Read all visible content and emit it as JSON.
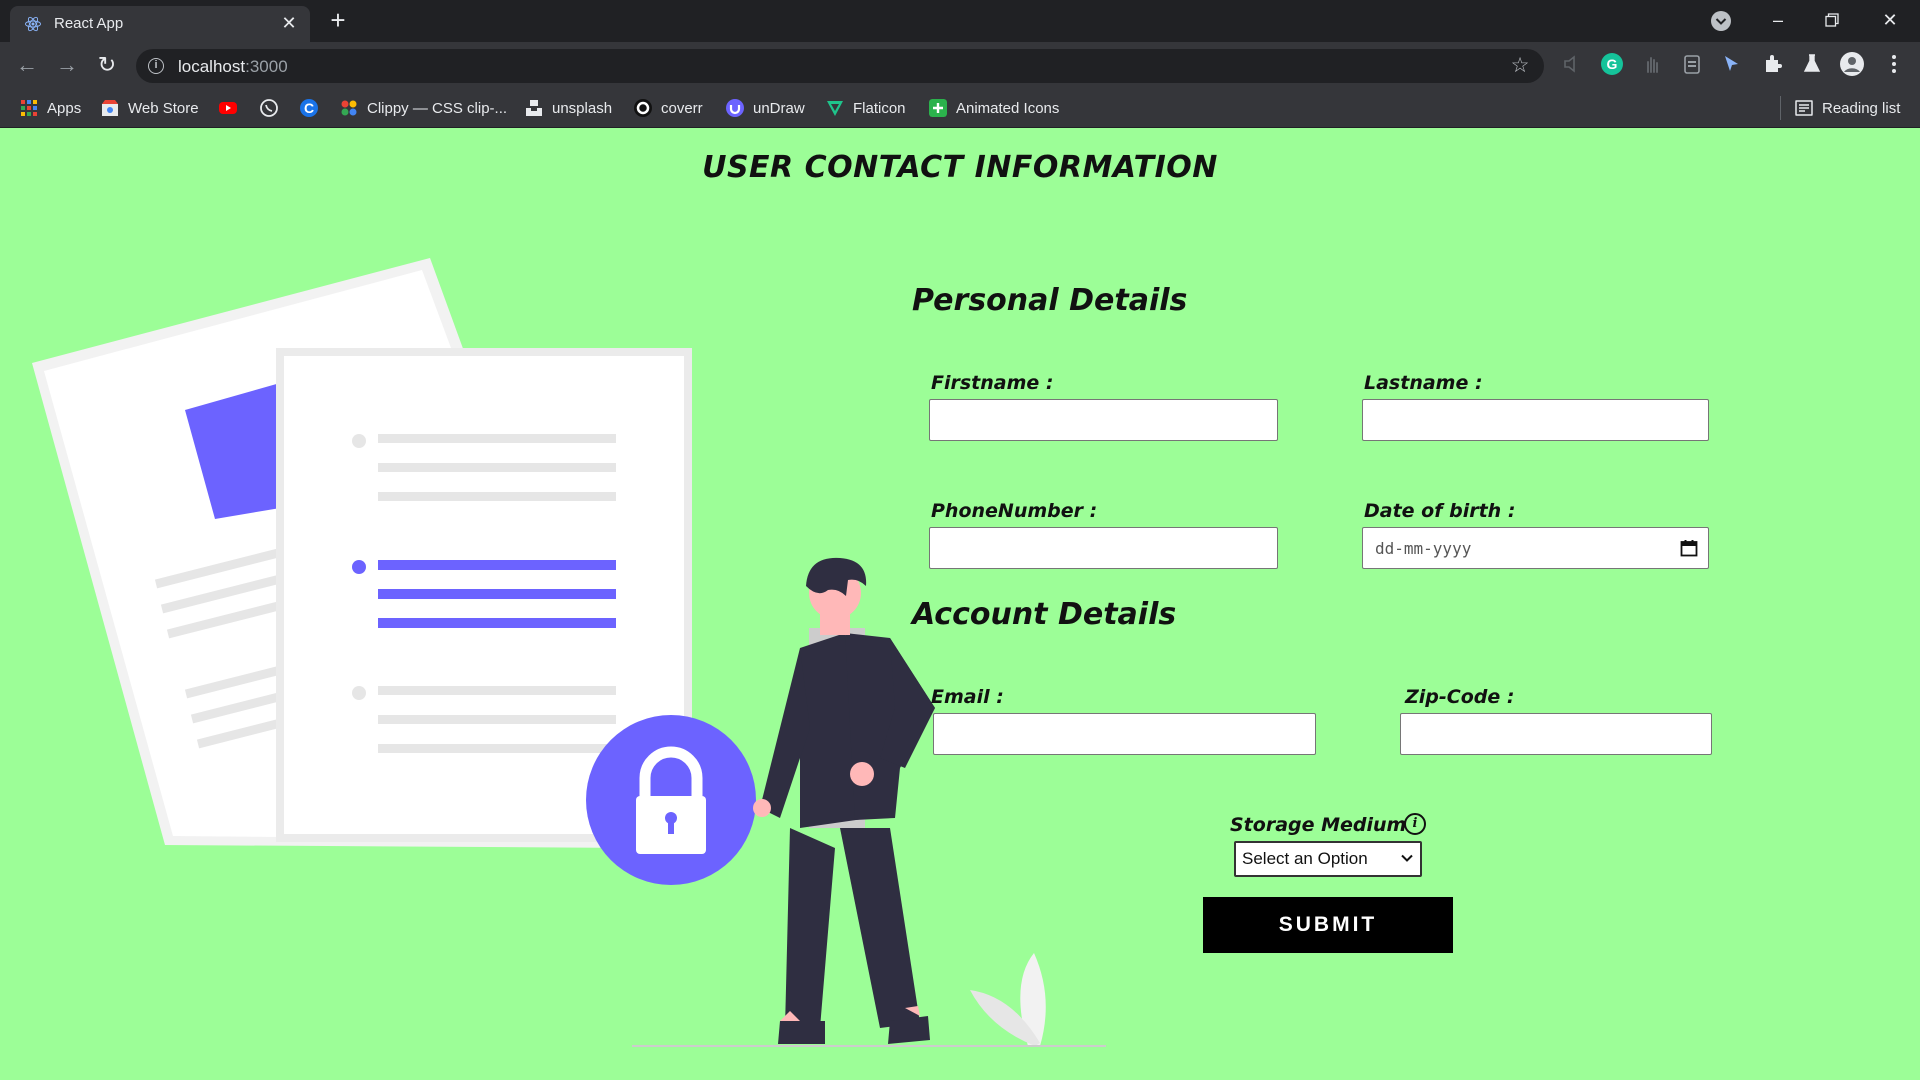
{
  "browser": {
    "tab_title": "React App",
    "url_host": "localhost",
    "url_port": ":3000",
    "bookmarks": [
      "Apps",
      "Web Store",
      "Clippy — CSS clip-...",
      "unsplash",
      "coverr",
      "unDraw",
      "Flaticon",
      "Animated Icons"
    ],
    "reading_list": "Reading list"
  },
  "page": {
    "title": "USER CONTACT INFORMATION",
    "personal": {
      "heading": "Personal Details",
      "firstname_label": "Firstname :",
      "lastname_label": "Lastname :",
      "phone_label": "PhoneNumber :",
      "dob_label": "Date of birth :",
      "dob_placeholder": "dd-mm-yyyy"
    },
    "account": {
      "heading": "Account Details",
      "email_label": "Email :",
      "zip_label": "Zip-Code :"
    },
    "storage": {
      "label": "Storage Medium",
      "info": "i",
      "selected": "Select an Option"
    },
    "submit_label": "SUBMIT"
  },
  "colors": {
    "page_bg": "#9cfe97",
    "accent": "#6c63ff",
    "chrome_dark": "#202124",
    "chrome": "#35363a"
  },
  "icons": [
    "react-icon",
    "close-icon",
    "plus-icon",
    "back-icon",
    "forward-icon",
    "reload-icon",
    "info-icon",
    "star-icon",
    "calendar-icon",
    "chevron-down-icon",
    "lock-icon"
  ]
}
